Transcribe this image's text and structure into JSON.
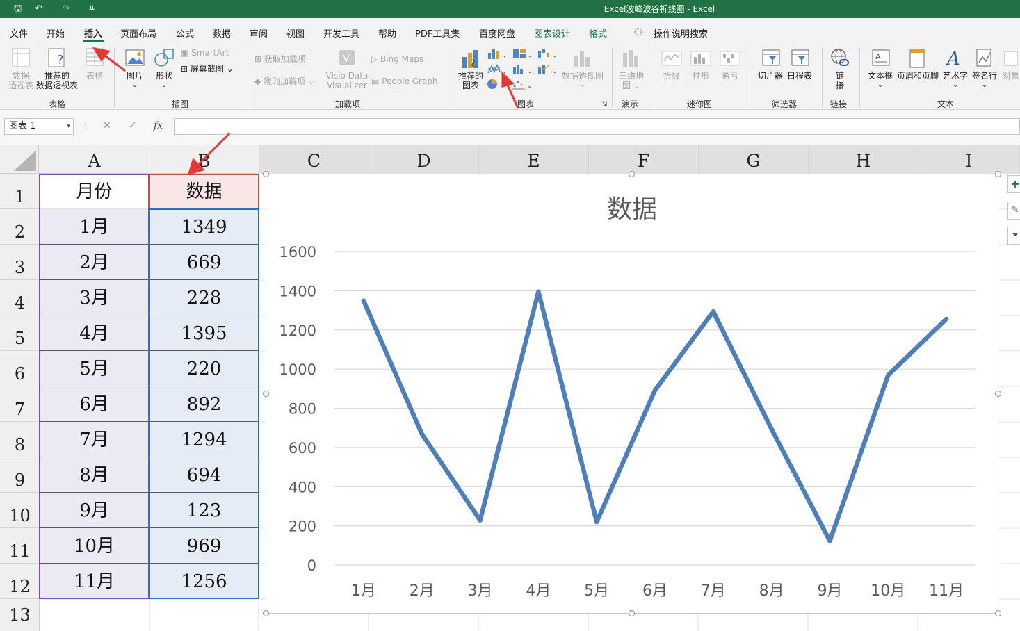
{
  "window": {
    "title": "Excel波峰波谷折线图  -  Excel"
  },
  "quick_access": {
    "save_glyph": "🖫",
    "undo_glyph": "↶",
    "redo_glyph": "↷",
    "customize_glyph": "⇊"
  },
  "menu": [
    {
      "label": "文件"
    },
    {
      "label": "开始"
    },
    {
      "label": "插入"
    },
    {
      "label": "页面布局"
    },
    {
      "label": "公式"
    },
    {
      "label": "数据"
    },
    {
      "label": "审阅"
    },
    {
      "label": "视图"
    },
    {
      "label": "开发工具"
    },
    {
      "label": "帮助"
    },
    {
      "label": "PDF工具集"
    },
    {
      "label": "百度网盘"
    },
    {
      "label": "图表设计"
    },
    {
      "label": "格式"
    },
    {
      "label": "操作说明搜索"
    }
  ],
  "ribbon": {
    "pivot_l1": "数据",
    "pivot_l2": "透视表",
    "rec_pivot_l1": "推荐的",
    "rec_pivot_l2": "数据透视表",
    "table": "表格",
    "picture": "图片",
    "shapes": "形状",
    "smartart": "SmartArt",
    "screenshot": "屏幕截图",
    "get_addins": "获取加载项",
    "my_addins": "我的加载项",
    "visio_l1": "Visio Data",
    "visio_l2": "Visualizer",
    "bing_maps": "Bing Maps",
    "people_graph": "People Graph",
    "rec_chart_l1": "推荐的",
    "rec_chart_l2": "图表",
    "pivot_chart": "数据透视图",
    "map3d_l1": "三维地",
    "map3d_l2": "图",
    "spark_line": "折线",
    "spark_col": "柱形",
    "spark_wl": "盈亏",
    "slicer": "切片器",
    "timeline": "日程表",
    "link_l1": "链",
    "link_l2": "接",
    "textbox": "文本框",
    "header_footer": "页眉和页脚",
    "wordart": "艺术字",
    "signature": "签名行",
    "object": "对象",
    "groups": {
      "tables": "表格",
      "illustrations": "插图",
      "addins": "加载项",
      "charts": "图表",
      "tours": "演示",
      "sparklines": "迷你图",
      "filters": "筛选器",
      "links": "链接",
      "text": "文本"
    }
  },
  "formula_bar": {
    "name_box": "图表 1",
    "cancel": "✕",
    "enter": "✓",
    "fx": "fx",
    "value": ""
  },
  "columns": [
    "A",
    "B",
    "C",
    "D",
    "E",
    "F",
    "G",
    "H",
    "I"
  ],
  "rows": [
    "1",
    "2",
    "3",
    "4",
    "5",
    "6",
    "7",
    "8",
    "9",
    "10",
    "11",
    "12",
    "13"
  ],
  "sheet": {
    "header_a": "月份",
    "header_b": "数据",
    "data": [
      {
        "month": "1月",
        "value": "1349"
      },
      {
        "month": "2月",
        "value": "669"
      },
      {
        "month": "3月",
        "value": "228"
      },
      {
        "month": "4月",
        "value": "1395"
      },
      {
        "month": "5月",
        "value": "220"
      },
      {
        "month": "6月",
        "value": "892"
      },
      {
        "month": "7月",
        "value": "1294"
      },
      {
        "month": "8月",
        "value": "694"
      },
      {
        "month": "9月",
        "value": "123"
      },
      {
        "month": "10月",
        "value": "969"
      },
      {
        "month": "11月",
        "value": "1256"
      }
    ]
  },
  "chart_data": {
    "type": "line",
    "title": "数据",
    "categories": [
      "1月",
      "2月",
      "3月",
      "4月",
      "5月",
      "6月",
      "7月",
      "8月",
      "9月",
      "10月",
      "11月"
    ],
    "series": [
      {
        "values": [
          1349,
          669,
          228,
          1395,
          220,
          892,
          1294,
          694,
          123,
          969,
          1256
        ]
      }
    ],
    "y_ticks": [
      0,
      200,
      400,
      600,
      800,
      1000,
      1200,
      1400,
      1600
    ],
    "ylim": [
      0,
      1600
    ],
    "grid": true,
    "legend": "none",
    "line_color": "#4f7fba",
    "grid_color": "#d9d9d9"
  },
  "colors": {
    "excel_green": "#217346",
    "arrow_red": "#e53935"
  }
}
